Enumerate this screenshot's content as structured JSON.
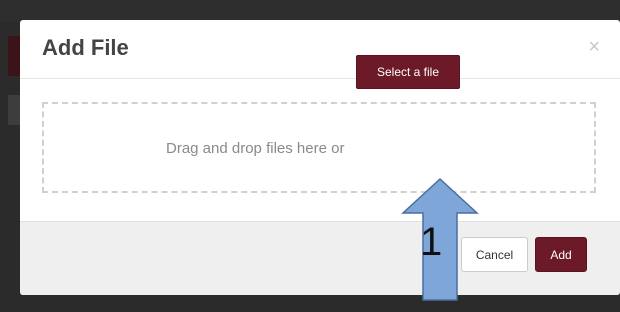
{
  "dialog": {
    "title": "Add File",
    "close_glyph": "×",
    "drop_text": "Drag and drop files here or",
    "select_label": "Select a file",
    "cancel_label": "Cancel",
    "add_label": "Add"
  },
  "annotation": {
    "number": "1",
    "arrow_color": "#7ea6d8",
    "arrow_stroke": "#4a6fa0"
  },
  "colors": {
    "accent": "#6d1a28",
    "overlay": "#2b2b2b",
    "footer": "#efefef"
  },
  "icons": {
    "close": "close-icon",
    "arrow": "up-arrow-icon"
  }
}
